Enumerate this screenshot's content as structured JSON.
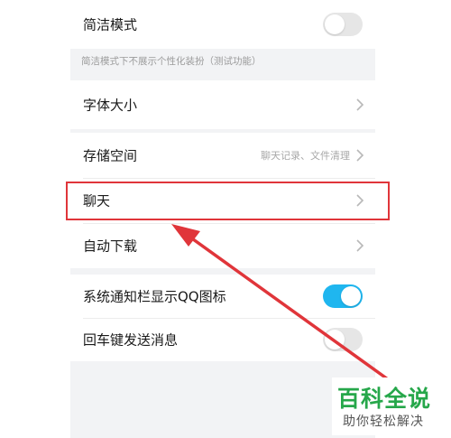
{
  "settings": {
    "simple_mode": {
      "label": "简洁模式",
      "hint": "简洁模式下不展示个性化装扮（测试功能）",
      "toggle": "off"
    },
    "font_size": {
      "label": "字体大小"
    },
    "storage": {
      "label": "存储空间",
      "subtitle": "聊天记录、文件清理"
    },
    "chat": {
      "label": "聊天"
    },
    "auto_download": {
      "label": "自动下载"
    },
    "notification_qq_icon": {
      "label": "系统通知栏显示QQ图标",
      "toggle": "on"
    },
    "enter_to_send": {
      "label": "回车键发送消息",
      "toggle": "off"
    }
  },
  "watermark": {
    "title": "百科全说",
    "subtitle": "助你轻松解决"
  },
  "colors": {
    "highlight": "#e0353a",
    "toggle_on": "#1fb6ef",
    "watermark_green": "#26a74a"
  },
  "icons": {
    "chevron": "chevron-right-icon",
    "arrow": "annotation-arrow-icon"
  }
}
